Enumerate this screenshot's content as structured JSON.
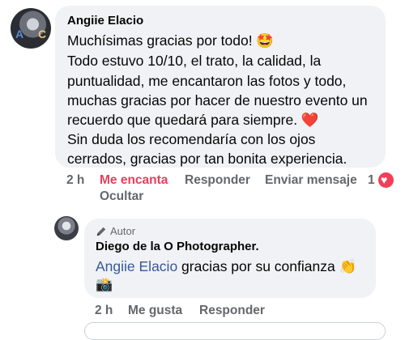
{
  "comment": {
    "author": "Angiie Elacio",
    "avatar_letters": [
      "A",
      "C"
    ],
    "lines": [
      "Muchísimas gracias por todo! 🤩",
      "Todo estuvo 10/10, el trato, la calidad, la",
      "puntualidad, me encantaron las fotos y todo,",
      "muchas gracias por hacer de nuestro evento un",
      "recuerdo que quedará para siempre. ❤️",
      "Sin duda los recomendaría con los ojos",
      "cerrados, gracias por tan bonita experiencia."
    ],
    "time": "2 h",
    "reaction_label": "Me encanta",
    "reply_label": "Responder",
    "message_label": "Enviar mensaje",
    "hide_label": "Ocultar",
    "reaction_count": "1"
  },
  "reply": {
    "badge": "Autor",
    "author": "Diego de la O Photographer.",
    "mention": "Angiie Elacio",
    "text": " gracias por su confianza 👏",
    "camera": "📸",
    "time": "2 h",
    "like_label": "Me gusta",
    "reply_label": "Responder"
  },
  "colors": {
    "bubble": "#f0f2f5",
    "meta": "#65676b",
    "love": "#e4405f",
    "mention": "#385898"
  }
}
